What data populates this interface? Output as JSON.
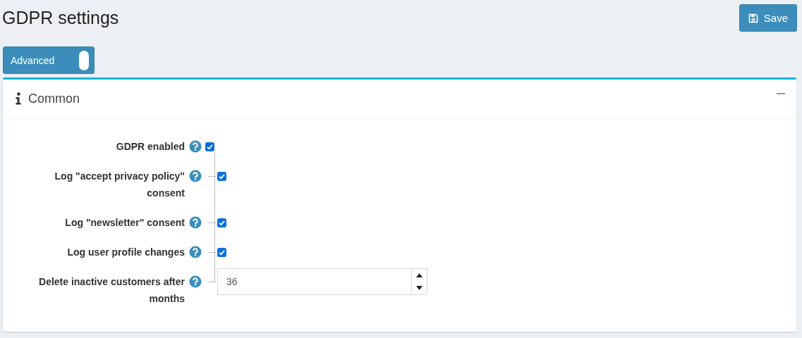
{
  "title": "GDPR settings",
  "save_button": {
    "label": "Save"
  },
  "advanced_toggle": {
    "label": "Advanced",
    "on": true
  },
  "panel": {
    "title": "Common",
    "expanded": true,
    "rows": [
      {
        "kind": "checkbox",
        "label": "GDPR enabled",
        "checked": true
      },
      {
        "kind": "checkbox",
        "label": "Log \"accept privacy policy\" consent",
        "checked": true
      },
      {
        "kind": "checkbox",
        "label": "Log \"newsletter\" consent",
        "checked": true
      },
      {
        "kind": "checkbox",
        "label": "Log user profile changes",
        "checked": true
      },
      {
        "kind": "number",
        "label": "Delete inactive customers after months",
        "value": "36"
      }
    ]
  }
}
